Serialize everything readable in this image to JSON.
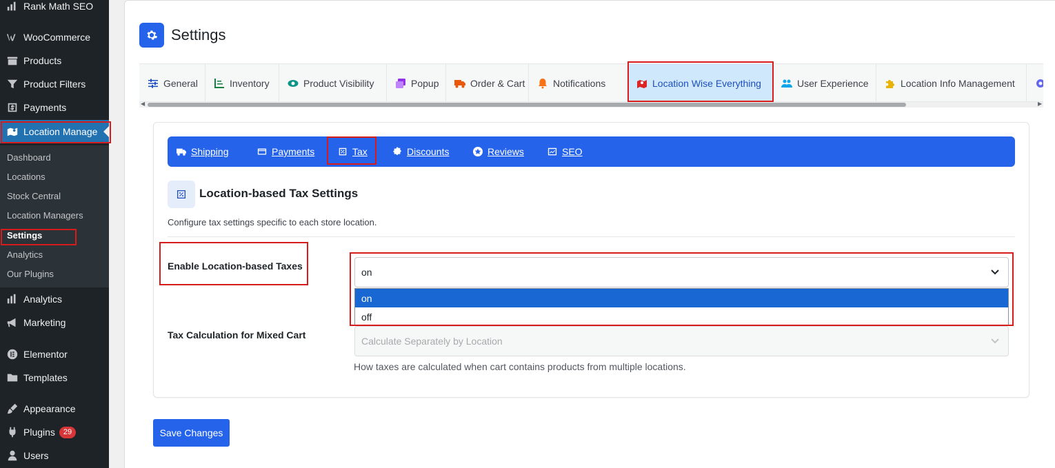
{
  "sidebar": {
    "menu": [
      {
        "label": "Rank Math SEO",
        "icon": "rank-math-icon"
      },
      {
        "label": "WooCommerce",
        "icon": "woocommerce-icon"
      },
      {
        "label": "Products",
        "icon": "products-icon"
      },
      {
        "label": "Product Filters",
        "icon": "filter-icon"
      },
      {
        "label": "Payments",
        "icon": "payments-icon"
      },
      {
        "label": "Location Manage",
        "icon": "location-map-icon"
      },
      {
        "label": "Analytics",
        "icon": "analytics-icon"
      },
      {
        "label": "Marketing",
        "icon": "megaphone-icon"
      },
      {
        "label": "Elementor",
        "icon": "elementor-icon"
      },
      {
        "label": "Templates",
        "icon": "folder-icon"
      },
      {
        "label": "Appearance",
        "icon": "paintbrush-icon"
      },
      {
        "label": "Plugins",
        "icon": "plugin-icon",
        "badge": "29"
      },
      {
        "label": "Users",
        "icon": "user-icon"
      }
    ],
    "submenu": [
      "Dashboard",
      "Locations",
      "Stock Central",
      "Location Managers",
      "Settings",
      "Analytics",
      "Our Plugins"
    ]
  },
  "page": {
    "title": "Settings"
  },
  "tabs": [
    {
      "label": "General",
      "icon": "sliders-icon"
    },
    {
      "label": "Inventory",
      "icon": "chart-line-icon"
    },
    {
      "label": "Product Visibility",
      "icon": "eye-icon"
    },
    {
      "label": "Popup",
      "icon": "window-restore-icon"
    },
    {
      "label": "Order & Cart",
      "icon": "truck-icon"
    },
    {
      "label": "Notifications",
      "icon": "bell-icon"
    },
    {
      "label": "Location Wise Everything",
      "icon": "map-location-icon"
    },
    {
      "label": "User Experience",
      "icon": "users-icon"
    },
    {
      "label": "Location Info Management",
      "icon": "puzzle-icon"
    }
  ],
  "subtabs": [
    {
      "label": "Shipping",
      "icon": "shipping-truck-icon"
    },
    {
      "label": "Payments",
      "icon": "credit-card-icon"
    },
    {
      "label": "Tax",
      "icon": "percent-icon"
    },
    {
      "label": "Discounts",
      "icon": "discount-badge-icon"
    },
    {
      "label": "Reviews",
      "icon": "star-icon"
    },
    {
      "label": "SEO",
      "icon": "seo-chart-icon"
    }
  ],
  "section": {
    "title": "Location-based Tax Settings",
    "description": "Configure tax settings specific to each store location."
  },
  "fields": {
    "enable_taxes": {
      "label": "Enable Location-based Taxes",
      "value": "on",
      "options": [
        "on",
        "off"
      ],
      "highlighted_option": "on"
    },
    "mixed_cart": {
      "label": "Tax Calculation for Mixed Cart",
      "value": "Calculate Separately by Location",
      "help": "How taxes are calculated when cart contains products from multiple locations."
    }
  },
  "save_label": "Save Changes",
  "colors": {
    "accent": "#2563eb",
    "sidebar_bg": "#1d2327",
    "highlight_border": "#d81b1b",
    "active_tab_bg": "#cfe8fc"
  }
}
